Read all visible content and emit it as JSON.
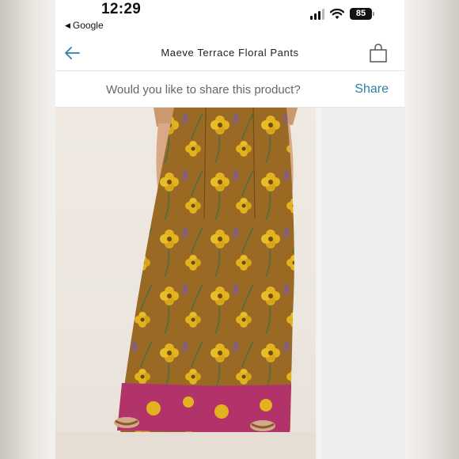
{
  "status": {
    "time": "12:29",
    "back_app": "Google",
    "battery": "85"
  },
  "nav": {
    "title": "Maeve Terrace Floral Pants"
  },
  "share": {
    "question": "Would you like to share this product?",
    "action": "Share"
  },
  "colors": {
    "accent": "#2f7fa6",
    "pants_base": "#9a6a25",
    "flower": "#e2b21f",
    "border_band": "#b2336a"
  }
}
